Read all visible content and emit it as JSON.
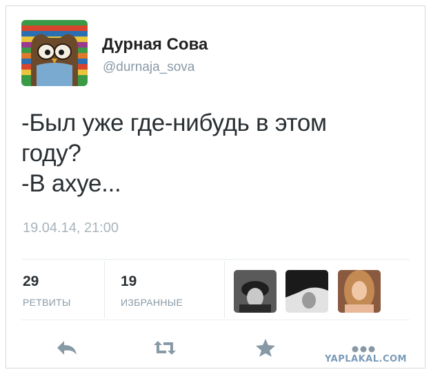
{
  "author": {
    "display_name": "Дурная Сова",
    "handle": "@durnaja_sova",
    "avatar_icon": "owl-avatar"
  },
  "tweet": {
    "lines": [
      "-Был уже где-нибудь в этом",
      "году?",
      "-В ахуе..."
    ],
    "timestamp": "19.04.14, 21:00"
  },
  "stats": {
    "retweets_count": "29",
    "retweets_label": "РЕТВИТЫ",
    "favorites_count": "19",
    "favorites_label": "ИЗБРАННЫЕ"
  },
  "favoriters": [
    "user-thumb-1",
    "user-thumb-2",
    "user-thumb-3"
  ],
  "actions": [
    "reply-icon",
    "retweet-icon",
    "favorite-icon",
    "more-icon"
  ],
  "watermark": "YAPLAKAL.COM",
  "colors": {
    "text": "#292f33",
    "secondary": "#8899a6",
    "action_icon": "#8899a6"
  }
}
